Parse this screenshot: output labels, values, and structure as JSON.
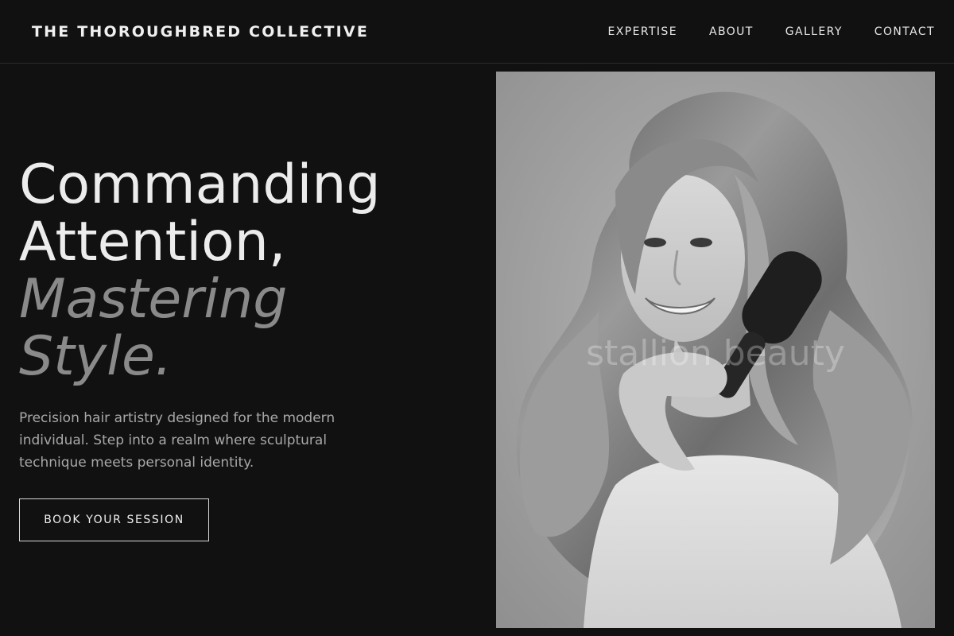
{
  "header": {
    "brand": "THE THOROUGHBRED COLLECTIVE",
    "nav": [
      {
        "label": "EXPERTISE"
      },
      {
        "label": "ABOUT"
      },
      {
        "label": "GALLERY"
      },
      {
        "label": "CONTACT"
      }
    ]
  },
  "hero": {
    "title_line1": "Commanding",
    "title_line2": "Attention,",
    "title_accent_line1": "Mastering",
    "title_accent_line2": "Style.",
    "description": "Precision hair artistry designed for the modern individual. Step into a realm where sculptural technique meets personal identity.",
    "cta_label": "BOOK YOUR SESSION"
  },
  "photo": {
    "watermark": "stallion beauty",
    "style": "black-and-white portrait"
  },
  "colors": {
    "background": "#111111",
    "text_primary": "#ececec",
    "text_muted": "#8a8a8a",
    "text_body": "#a8a8a8",
    "border": "#d9d9d9"
  }
}
